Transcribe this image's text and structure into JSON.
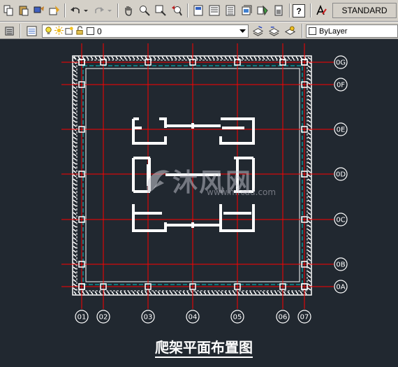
{
  "toolbar": {
    "text_style": "STANDARD",
    "help_label": "?"
  },
  "layers": {
    "current_layer": "0",
    "color": "ByLayer"
  },
  "drawing": {
    "caption": "爬架平面布置图",
    "axes_bottom": [
      "01",
      "02",
      "03",
      "04",
      "05",
      "06",
      "07"
    ],
    "axes_right": [
      "0G",
      "0F",
      "0E",
      "0D",
      "0C",
      "0B",
      "0A"
    ]
  },
  "watermark": {
    "brand": "沐风网",
    "url": "www.mfcad.com"
  },
  "colors": {
    "background": "#212830",
    "grid": "#ff0000",
    "dashed": "#00c8c8",
    "lines": "#ffffff"
  }
}
